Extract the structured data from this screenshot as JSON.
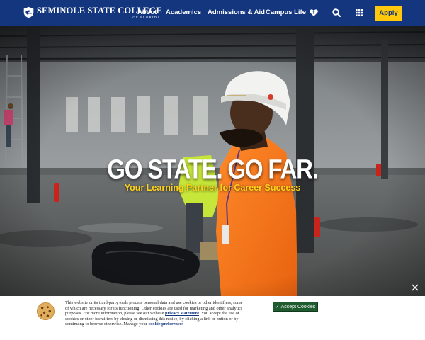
{
  "header": {
    "logo_name": "SEMINOLE STATE COLLEGE",
    "logo_sub": "OF FLORIDA",
    "nav": [
      {
        "label": "About"
      },
      {
        "label": "Academics"
      },
      {
        "label": "Admissions & Aid"
      },
      {
        "label": "Campus Life"
      }
    ],
    "icons": [
      "donate-heart-icon",
      "search-icon",
      "grid-menu-icon"
    ],
    "apply_label": "Apply",
    "colors": {
      "bar": "#13367f",
      "apply": "#ffc80a"
    }
  },
  "hero": {
    "title": "GO STATE. GO FAR.",
    "subtitle": "Your Learning Partner for Career Success",
    "close_icon": "close-icon"
  },
  "cookie_banner": {
    "text_main": "This website or its third-party tools process personal data and use cookies or other identifiers, some of which are necessary for its functioning. Other cookies are used for marketing and other analytics purposes. For more information, please see our website",
    "privacy_link": "privacy statement",
    "text_after": ". You accept the use of cookies or other identifiers by closing or dismissing this notice, by clicking a link or button or by continuing to browse otherwise. Manage your",
    "prefs_link": "cookie preferences",
    "accept_label": "Accept Cookies",
    "icon": "cookie-icon"
  }
}
